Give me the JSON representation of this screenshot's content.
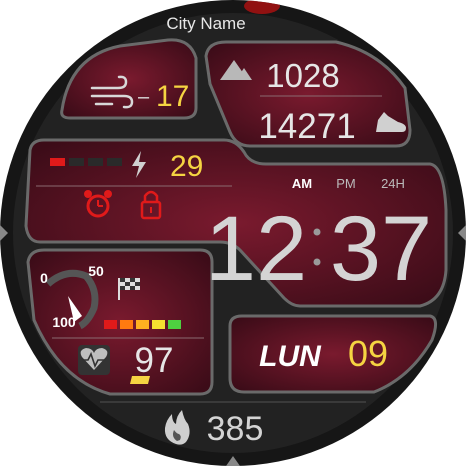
{
  "location": {
    "city": "City Name"
  },
  "weather": {
    "wind_value": "17",
    "wind_sign": "–",
    "icon": "wind-icon"
  },
  "environment": {
    "pressure": "1028",
    "steps": "14271",
    "icons": [
      "mountain-icon",
      "shoe-icon"
    ]
  },
  "battery": {
    "value": "29",
    "icon": "lightning-icon",
    "level_segments_filled": 1,
    "level_segments_total": 4
  },
  "status": {
    "icons": [
      "alarm-clock-icon",
      "lock-icon"
    ]
  },
  "time": {
    "hours": "12",
    "minutes": "37",
    "am": "AM",
    "pm": "PM",
    "h24": "24H"
  },
  "gauge": {
    "min": "0",
    "mid": "50",
    "max": "100",
    "icon": "checkered-flag-icon"
  },
  "heart": {
    "value": "97",
    "icon": "heart-rate-icon"
  },
  "date": {
    "day": "LUN",
    "date": "09"
  },
  "calories": {
    "value": "385",
    "icon": "flame-icon"
  },
  "colors": {
    "accent": "#f5d442",
    "red": "#e01a1a",
    "panel": "#4a0f1e",
    "bezel": "#1c1c1c"
  }
}
